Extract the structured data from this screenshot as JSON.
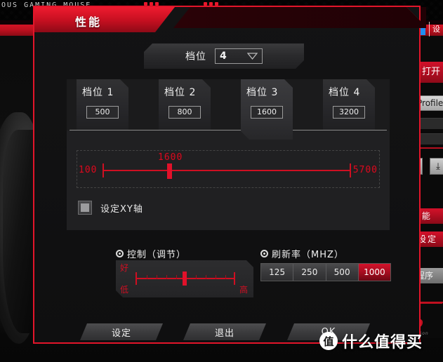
{
  "background": {
    "brand_strip": "OUS GAMING MOUSE",
    "window_title": "设",
    "open_tab_label": "打开",
    "profile_label": "Profile",
    "icons": [
      {
        "name": "book-icon",
        "glyph": "▤"
      },
      {
        "name": "download-icon",
        "glyph": "⤓"
      }
    ],
    "menu_items": [
      {
        "name": "performance",
        "label": "性 能"
      },
      {
        "name": "lighting",
        "label": "光设定"
      },
      {
        "name": "bind-program",
        "label": "到程序"
      }
    ],
    "esport_logo": "eSPO",
    "esport_sub": "esport edition"
  },
  "dialog": {
    "title": "性能",
    "gear_selector": {
      "label": "档位",
      "value": "4",
      "caret_icon": "chevron-down-icon"
    },
    "tabs": [
      {
        "label": "档位 1",
        "value": "500",
        "active": false
      },
      {
        "label": "档位 2",
        "value": "800",
        "active": false
      },
      {
        "label": "档位 3",
        "value": "1600",
        "active": true
      },
      {
        "label": "档位 4",
        "value": "3200",
        "active": false
      }
    ],
    "dpi_slider": {
      "min": "100",
      "max": "5700",
      "current": "1600",
      "percent": 27
    },
    "xy_checkbox": {
      "label": "设定XY轴",
      "checked": false
    },
    "control_section": {
      "title": "控制（调节）",
      "top_label": "好",
      "low_label": "低",
      "high_label": "高",
      "percent": 50
    },
    "polling_section": {
      "title": "刷新率（MHZ）",
      "options": [
        "125",
        "250",
        "500",
        "1000"
      ],
      "selected": "1000"
    },
    "buttons": [
      {
        "name": "set-button",
        "label": "设定"
      },
      {
        "name": "exit-button",
        "label": "退出"
      },
      {
        "name": "ok-button",
        "label": "OK"
      }
    ]
  },
  "watermark": {
    "logo": "值",
    "text": "什么值得买"
  },
  "colors": {
    "accent_red": "#e3152a",
    "panel_dark": "#202022",
    "slider_red": "#cf0f22",
    "selected_blue": "#1f8ef1"
  }
}
